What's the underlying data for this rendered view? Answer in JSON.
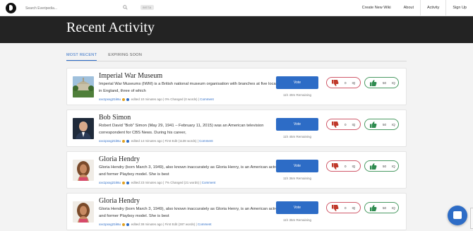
{
  "nav": {
    "search_placeholder": "Search Everipedia...",
    "beta": "BETA",
    "links": [
      "Create New Wiki",
      "About",
      "Activity",
      "Sign Up"
    ]
  },
  "hero": {
    "title": "Recent Activity"
  },
  "tabs": [
    "MOST RECENT",
    "EXPIRING SOON"
  ],
  "cards": [
    {
      "title": "Imperial War Museum",
      "excerpt": "Imperial War Museums (IWM) is a British national museum organisation with branches at five locations in England, three of which",
      "user": "xxx1pxxg21k6u",
      "edited": "edited 10 minutes ago",
      "change": "0% Changed (0 words)",
      "comment": "Comment",
      "vote": "Vote",
      "remaining": "11h 49m Remaining",
      "down_count": "0",
      "up_count": "50",
      "iq": "IQ"
    },
    {
      "title": "Bob Simon",
      "excerpt": "Robert David \"Bob\" Simon (May 29, 1941 – February 11, 2015) was an American television correspondent for CBS News. During his career,",
      "user": "xxx1pxxg21k6u",
      "edited": "edited 14 minutes ago",
      "change": "First Edit (1138 words)",
      "comment": "Comment",
      "vote": "Vote",
      "remaining": "11h 45m Remaining",
      "down_count": "0",
      "up_count": "50",
      "iq": "IQ"
    },
    {
      "title": "Gloria Hendry",
      "excerpt": "Gloria Hendry (born March 3, 1949), also known inaccurately as Gloria Henry, is an American actress and former Playboy model. She is best",
      "user": "xxx1pxxg21k6u",
      "edited": "edited 23 minutes ago",
      "change": "7% Changed (21 words)",
      "comment": "Comment",
      "vote": "Vote",
      "remaining": "11h 36m Remaining",
      "down_count": "0",
      "up_count": "50",
      "iq": "IQ"
    },
    {
      "title": "Gloria Hendry",
      "excerpt": "Gloria Hendry (born March 3, 1949), also known inaccurately as Gloria Henry, is an American actress and former Playboy model. She is best",
      "user": "xxx1pxxg21k6u",
      "edited": "edited 38 minutes ago",
      "change": "First Edit (287 words)",
      "comment": "Comment",
      "vote": "Vote",
      "remaining": "11h 35m Remaining",
      "down_count": "0",
      "up_count": "50",
      "iq": "IQ"
    }
  ],
  "colors": {
    "accent": "#2d6cc6",
    "downvote": "#d05a6a",
    "upvote": "#4a9a63",
    "hero": "#232323"
  }
}
